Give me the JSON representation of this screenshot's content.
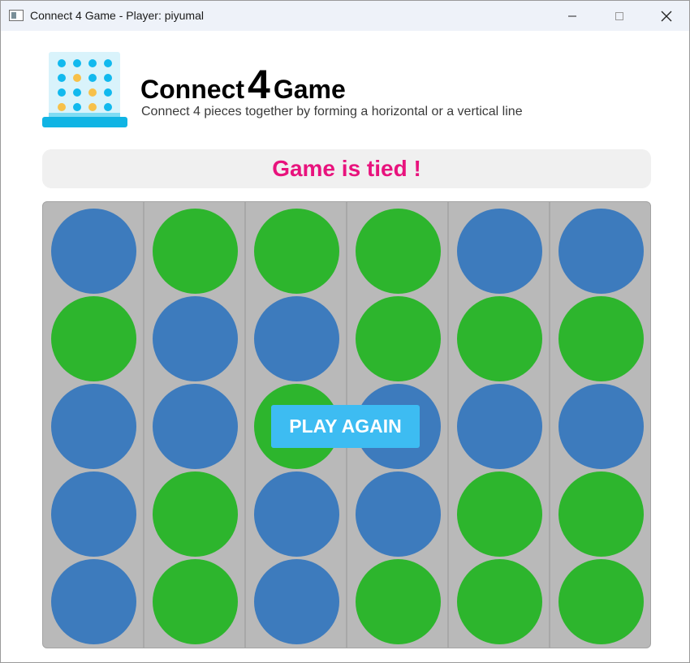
{
  "window": {
    "title": "Connect 4 Game - Player: piyumal",
    "icon": "app-window-icon",
    "controls": [
      "minimize-icon",
      "maximize-icon",
      "close-icon"
    ]
  },
  "header": {
    "title_before": "Connect",
    "title_number": "4",
    "title_after": "Game",
    "subtitle": "Connect 4 pieces together by forming a horizontal or a vertical line",
    "logo": "connect-four-board-icon"
  },
  "status": {
    "message": "Game is tied !",
    "color": "#e8137d"
  },
  "board": {
    "columns": 6,
    "rows": 5,
    "colors": {
      "blue": "#3d7bbd",
      "green": "#2db52d"
    },
    "cells": [
      [
        "blue",
        "green",
        "green",
        "green",
        "blue",
        "blue"
      ],
      [
        "green",
        "blue",
        "blue",
        "green",
        "green",
        "green"
      ],
      [
        "blue",
        "blue",
        "green",
        "blue",
        "blue",
        "blue"
      ],
      [
        "blue",
        "green",
        "blue",
        "blue",
        "green",
        "green"
      ],
      [
        "blue",
        "green",
        "blue",
        "green",
        "green",
        "green"
      ]
    ]
  },
  "actions": {
    "play_again_label": "PLAY AGAIN",
    "play_again_color": "#3dbcf2"
  }
}
